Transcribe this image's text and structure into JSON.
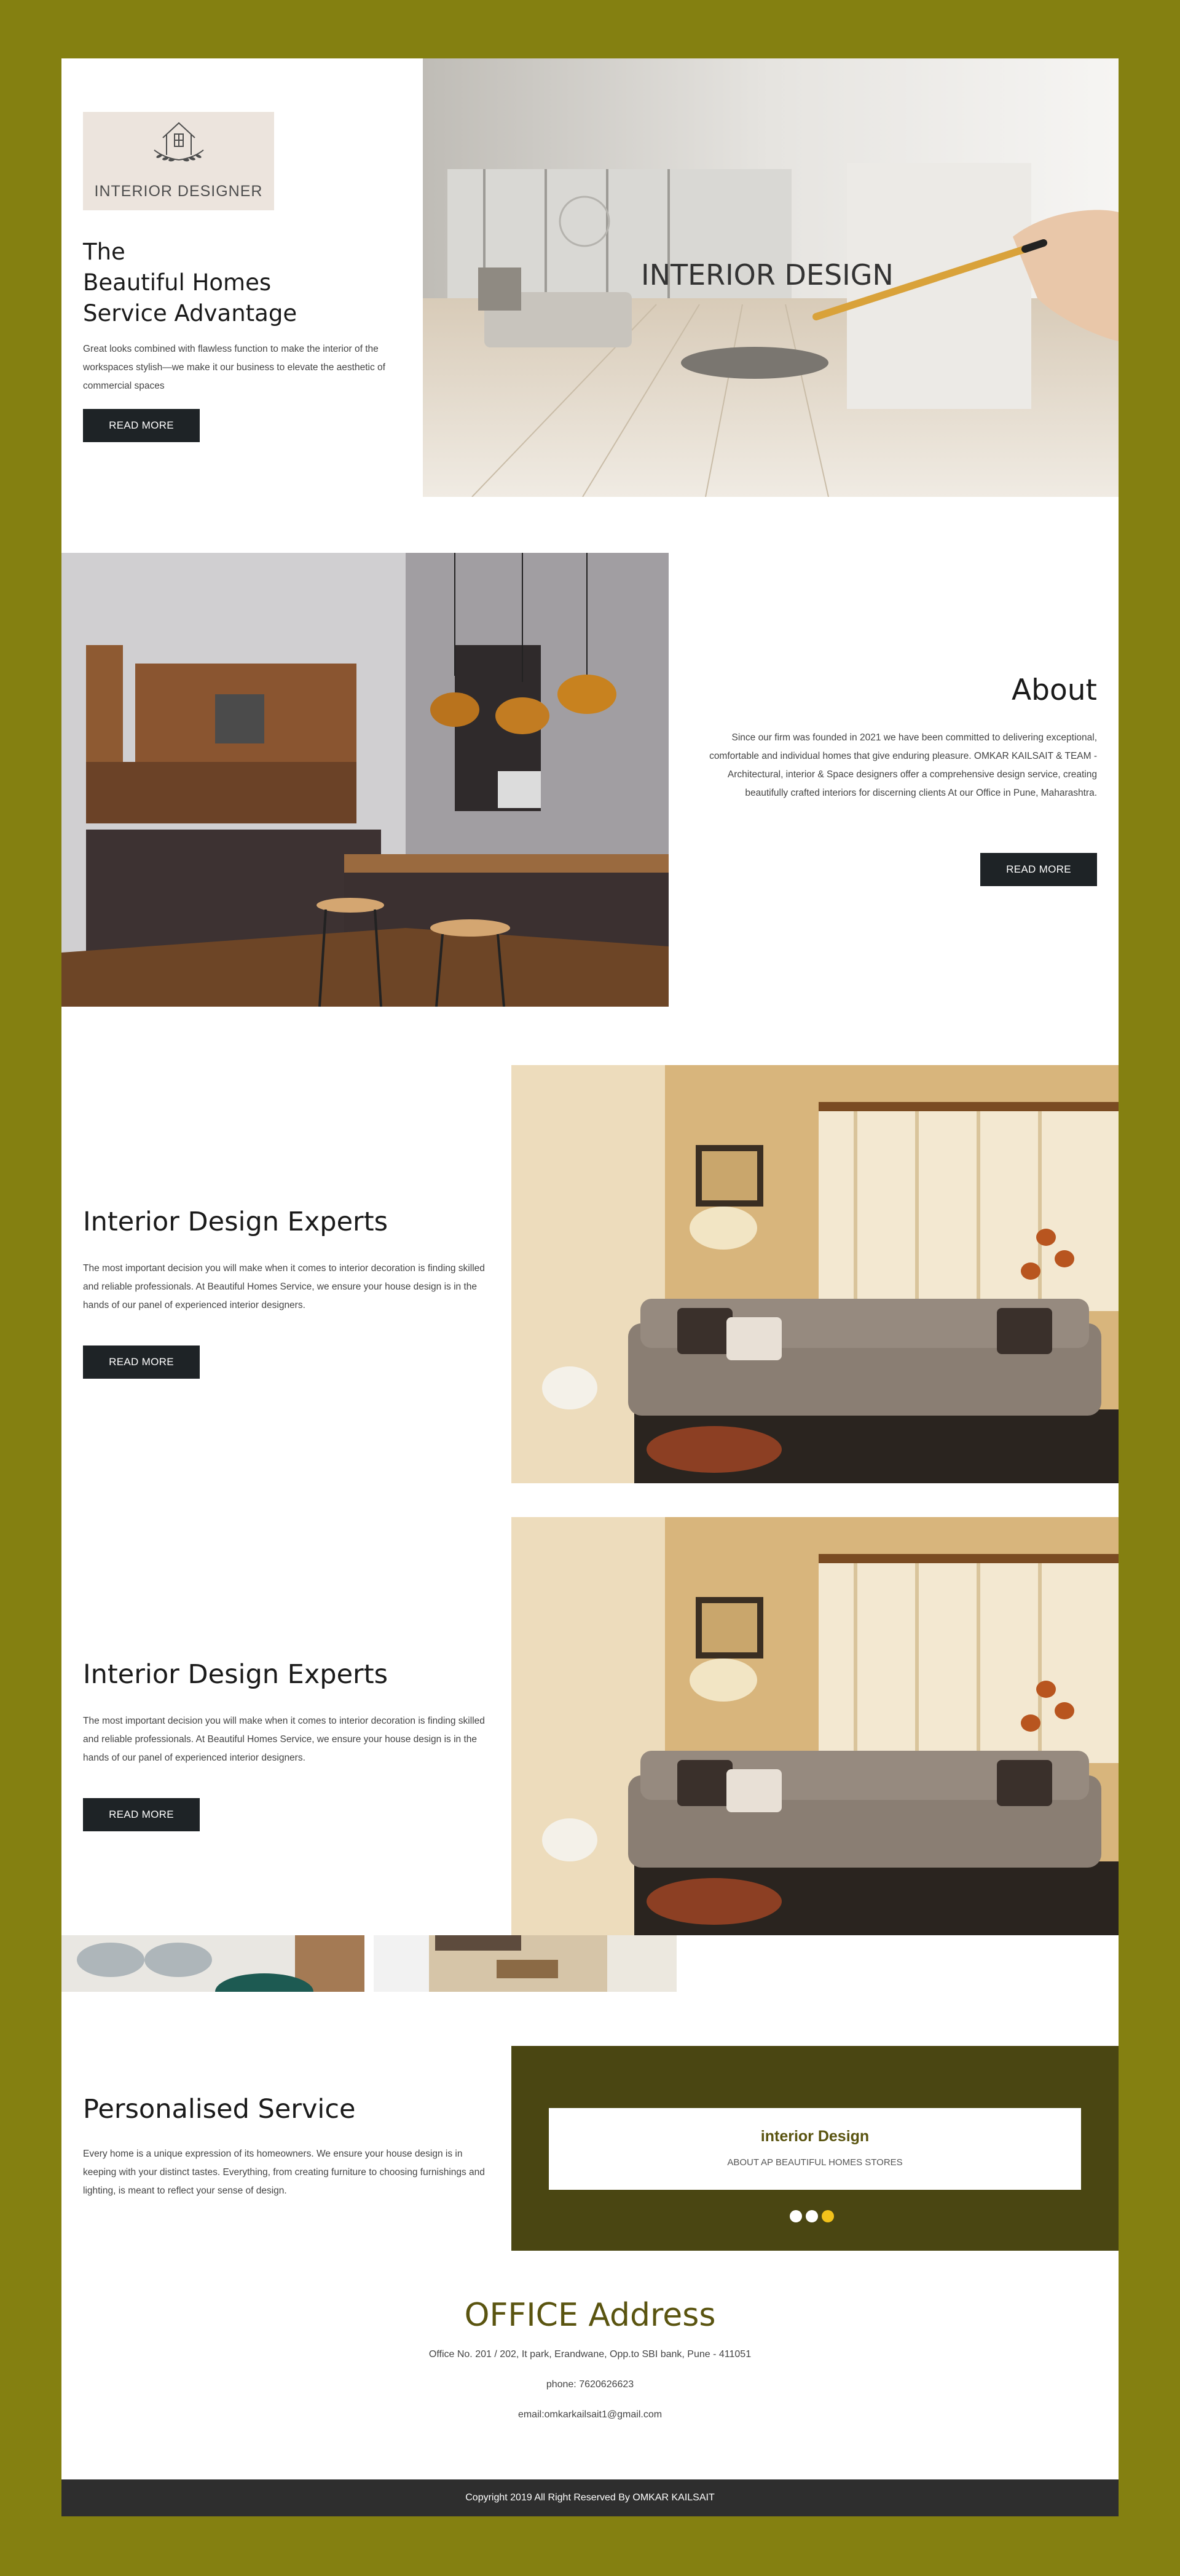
{
  "hero": {
    "logo_text": "INTERIOR DESIGNER",
    "title_line1": "The",
    "title_line2": "Beautiful Homes",
    "title_line3": "Service Advantage",
    "description": "Great looks combined with flawless function to make the interior of the workspaces stylish—we make it our business to elevate the aesthetic of commercial spaces",
    "button": "READ MORE",
    "image_overlay_text": "INTERIOR DESIGN"
  },
  "about": {
    "title": "About",
    "description": "Since our firm was founded in 2021 we have been committed to delivering exceptional, comfortable and individual homes that give enduring pleasure. OMKAR KAILSAIT & TEAM - Architectural, interior & Space designers offer a comprehensive design service, creating beautifully crafted interiors for discerning clients At our Office in Pune, Maharashtra.",
    "button": "READ MORE"
  },
  "experts": [
    {
      "title": "Interior Design Experts",
      "description": "The most important decision you will make when it comes to interior decoration is finding skilled and reliable professionals. At Beautiful Homes Service, we ensure your house design is in the hands of our panel of experienced interior designers.",
      "button": "READ MORE"
    },
    {
      "title": "Interior Design Experts",
      "description": "The most important decision you will make when it comes to interior decoration is finding skilled and reliable professionals. At Beautiful Homes Service, we ensure your house design is in the hands of our panel of experienced interior designers.",
      "button": "READ MORE"
    }
  ],
  "personalised": {
    "title": "Personalised Service",
    "description": "Every home is a unique expression of its homeowners. We ensure your house design is in keeping with your distinct tastes. Everything, from creating furniture to choosing furnishings and lighting, is meant to reflect your sense of design.",
    "card_title": "interior Design",
    "card_subtitle": "ABOUT AP BEAUTIFUL HOMES STORES",
    "slides_total": 3,
    "active_slide": 3
  },
  "office": {
    "title": "OFFICE Address",
    "address": "Office No. 201 / 202, It park, Erandwane, Opp.to SBI bank, Pune - 411051",
    "phone": "phone: 7620626623",
    "email": "email:omkarkailsait1@gmail.com"
  },
  "footer": {
    "copyright": "Copyright 2019 All Right Reserved By OMKAR KAILSAIT"
  },
  "colors": {
    "frame": "#848011",
    "dark_button": "#1e2326",
    "panel": "#4a4612",
    "accent_title": "#5a5410",
    "dot_active": "#f2c21b",
    "footer_bg": "#2e2e2e"
  }
}
